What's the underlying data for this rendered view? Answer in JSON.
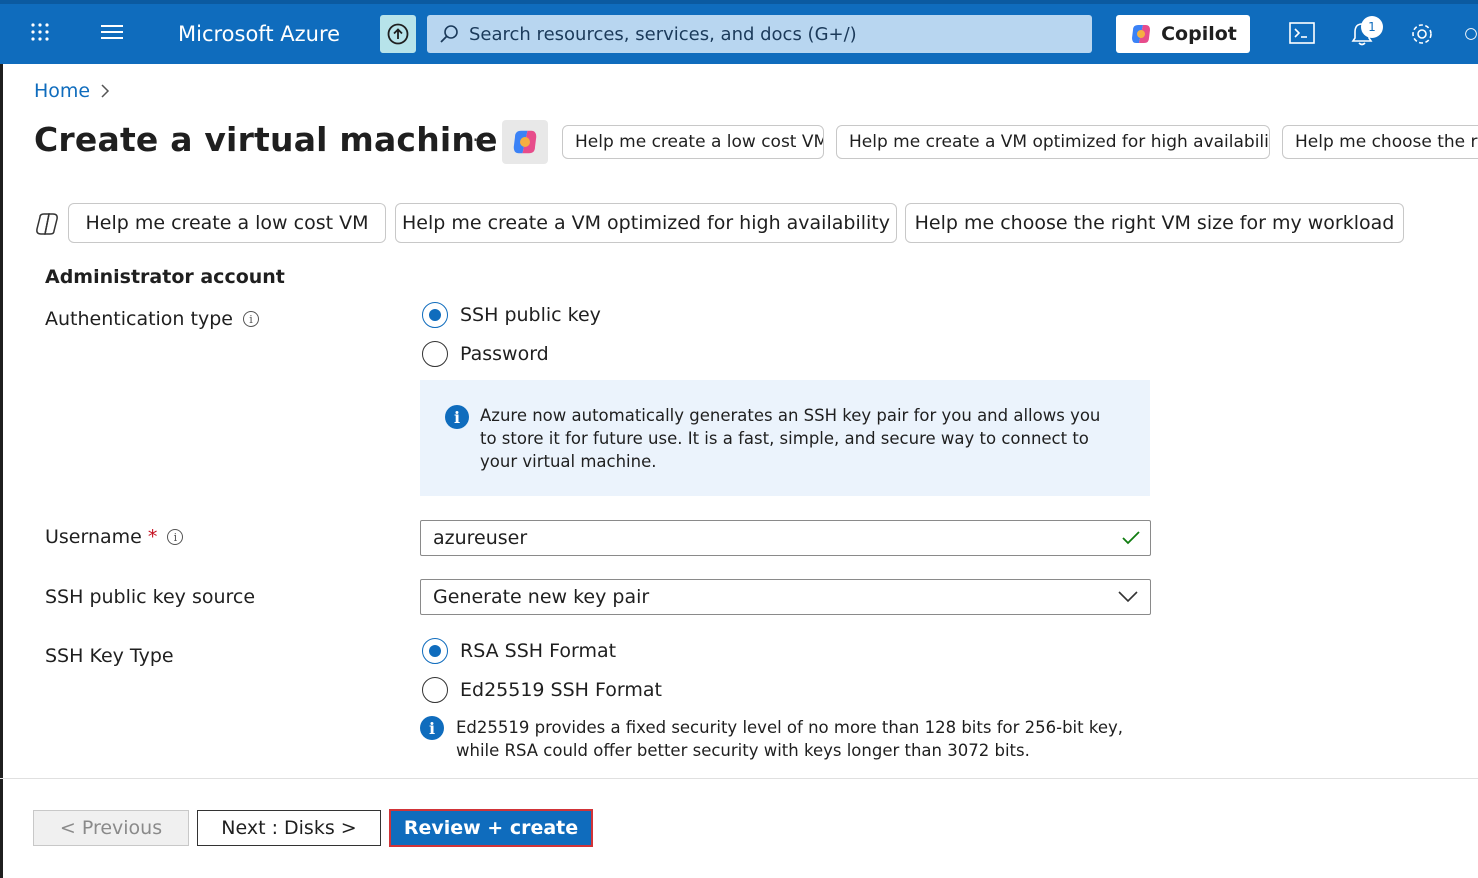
{
  "topbar": {
    "app_title": "Microsoft Azure",
    "search_placeholder": "Search resources, services, and docs (G+/)",
    "copilot_label": "Copilot",
    "notification_count": "1"
  },
  "header": {
    "breadcrumb_home": "Home",
    "page_title": "Create a virtual machine",
    "more_label": "···",
    "top_suggestions": [
      "Help me create a low cost VM",
      "Help me create a VM optimized for high availability",
      "Help me choose the rig"
    ],
    "suggestions": [
      "Help me create a low cost VM",
      "Help me create a VM optimized for high availability",
      "Help me choose the right VM size for my workload"
    ]
  },
  "form": {
    "section_heading": "Administrator account",
    "auth_type_label": "Authentication type",
    "auth_options": [
      "SSH public key",
      "Password"
    ],
    "auth_selected": 0,
    "auth_info": "Azure now automatically generates an SSH key pair for you and allows you to store it for future use. It is a fast, simple, and secure way to connect to your virtual machine.",
    "username_label": "Username",
    "required_mark": "*",
    "username_value": "azureuser",
    "key_source_label": "SSH public key source",
    "key_source_value": "Generate new key pair",
    "key_type_label": "SSH Key Type",
    "key_type_options": [
      "RSA SSH Format",
      "Ed25519 SSH Format"
    ],
    "key_type_selected": 0,
    "key_type_note": "Ed25519 provides a fixed security level of no more than 128 bits for 256-bit key, while RSA could offer better security with keys longer than 3072 bits."
  },
  "footer": {
    "previous_label": "< Previous",
    "next_label": "Next : Disks >",
    "review_label": "Review + create"
  },
  "colors": {
    "azure_blue": "#0f6cbd",
    "info_bg": "#ebf3fc",
    "required_red": "#c50f1f",
    "valid_green": "#107c10",
    "highlight_border": "#d13438"
  },
  "icons": [
    "app-launcher-icon",
    "hamburger-menu-icon",
    "upload-icon",
    "search-icon",
    "copilot-icon",
    "cloud-shell-icon",
    "bell-icon",
    "gear-icon",
    "help-icon",
    "chevron-right-icon",
    "info-icon",
    "checkmark-icon",
    "chevron-down-icon"
  ]
}
